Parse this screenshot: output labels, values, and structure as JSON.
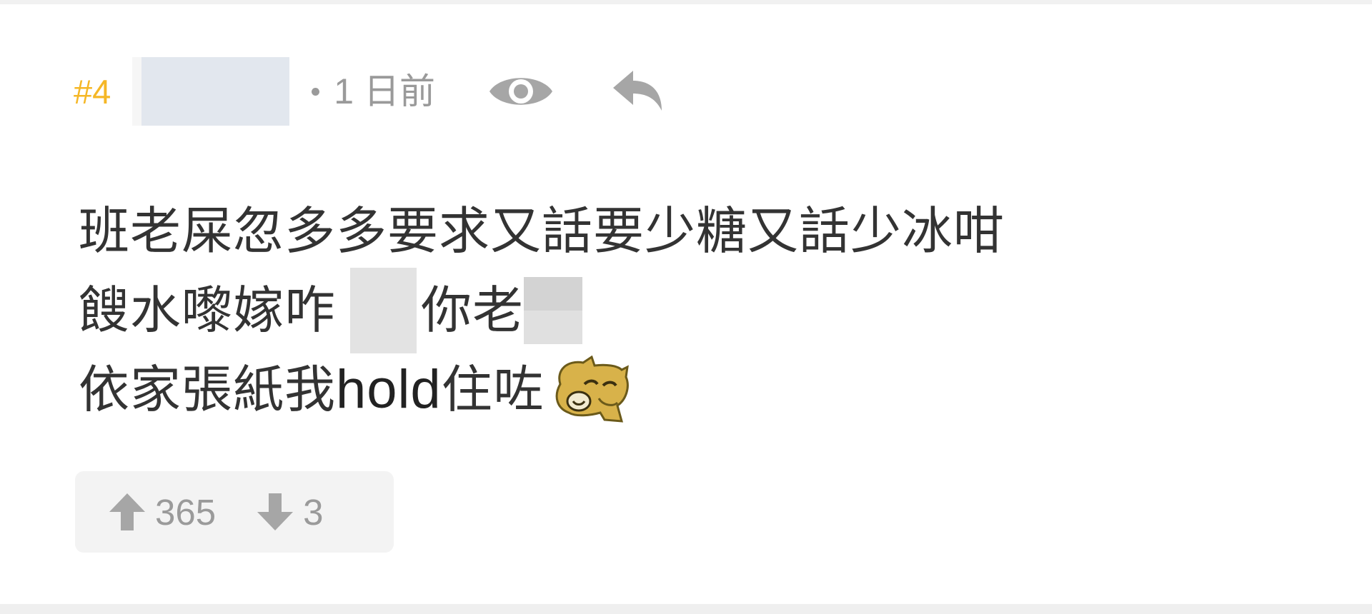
{
  "post": {
    "number": "#4",
    "time": "1 日前",
    "body_lines": {
      "line1": "班老屎忽多多要求又話要少糖又話少冰咁",
      "line2_a": "餿水嚟嫁咋",
      "line2_b": "你老",
      "line3_a": "依家張紙我",
      "line3_hold": "hold",
      "line3_b": "住咗"
    },
    "votes": {
      "up": "365",
      "down": "3"
    }
  },
  "icons": {
    "view": "eye-icon",
    "reply": "reply-icon",
    "upvote": "arrow-up-icon",
    "downvote": "arrow-down-icon",
    "emoji": "lihkg-dog-emoji"
  },
  "colors": {
    "post_number": "#f5b726",
    "meta_grey": "#9a9a9a",
    "text": "#333333"
  }
}
